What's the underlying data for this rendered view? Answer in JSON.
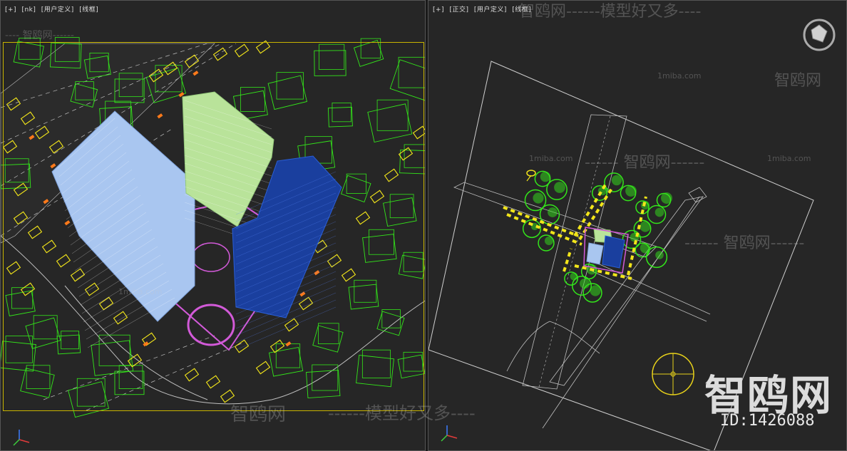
{
  "left_viewport": {
    "labels": [
      "[+]",
      "[nk]",
      "[用户定义]",
      "[线框]"
    ]
  },
  "right_viewport": {
    "labels": [
      "[+]",
      "[正交]",
      "[用户定义]",
      "[线框]"
    ]
  },
  "watermarks": {
    "top_dash": "---- 智鸥网------",
    "top_right_long": "智鸥网------模型好又多----",
    "site_small": "1miba.com",
    "site_cn": "智鸥网",
    "dash_cn": "------ 智鸥网------",
    "bottom_a": "智鸥网",
    "bottom_b": "------模型好又多----"
  },
  "brand": {
    "logo": "智鸥网",
    "id": "ID:1426088"
  },
  "colors": {
    "tree": "#33e61a",
    "car_yellow": "#f2e51a",
    "car_orange": "#ff7a1a",
    "tower_light_blue": "#a9c6f0",
    "tower_green": "#b9e39a",
    "tower_dark_blue": "#1a3f9e",
    "plaza_magenta": "#d25ad8",
    "road": "#bfbfbf",
    "frame_yellow": "#c8b400"
  }
}
